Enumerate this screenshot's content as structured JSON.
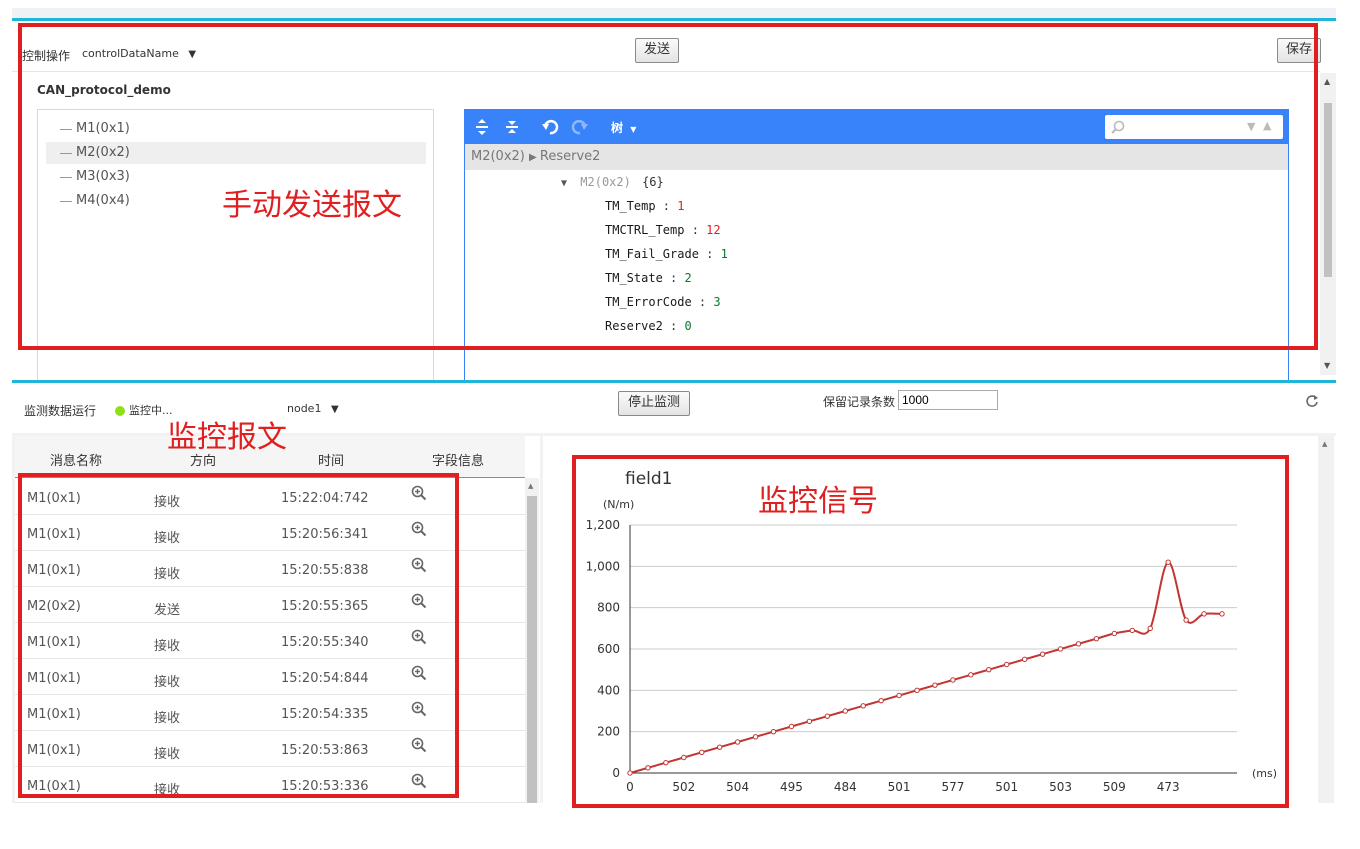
{
  "top": {
    "control_label": "控制操作",
    "control_select": "controlDataName",
    "send_button": "发送",
    "save_button": "保存",
    "protocol_title": "CAN_protocol_demo",
    "tree_items": [
      "M1(0x1)",
      "M2(0x2)",
      "M3(0x3)",
      "M4(0x4)"
    ],
    "selected_tree_index": 1,
    "json_editor": {
      "mode_label": "树",
      "search_placeholder": "",
      "breadcrumb": [
        "M2(0x2)",
        "Reserve2"
      ],
      "root_label": "M2(0x2)",
      "root_count": "{6}",
      "fields": [
        {
          "key": "TM_Temp",
          "value": "1",
          "color": "#e02020"
        },
        {
          "key": "TMCTRL_Temp",
          "value": "12",
          "color": "#e02020"
        },
        {
          "key": "TM_Fail_Grade",
          "value": "1",
          "color": "#0a7a2a"
        },
        {
          "key": "TM_State",
          "value": "2",
          "color": "#0a7a2a"
        },
        {
          "key": "TM_ErrorCode",
          "value": "3",
          "color": "#0a7a2a"
        },
        {
          "key": "Reserve2",
          "value": "0",
          "color": "#0a7a2a"
        }
      ]
    },
    "annotation": "手动发送报文"
  },
  "bottom": {
    "monitor_label": "监测数据运行",
    "status_text": "监控中...",
    "node_select": "node1",
    "stop_button": "停止监测",
    "retain_label": "保留记录条数",
    "retain_value": "1000",
    "table_headers": [
      "消息名称",
      "方向",
      "时间",
      "字段信息"
    ],
    "rows": [
      {
        "name": "M1(0x1)",
        "dir": "接收",
        "time": "15:22:04:742"
      },
      {
        "name": "M1(0x1)",
        "dir": "接收",
        "time": "15:20:56:341"
      },
      {
        "name": "M1(0x1)",
        "dir": "接收",
        "time": "15:20:55:838"
      },
      {
        "name": "M2(0x2)",
        "dir": "发送",
        "time": "15:20:55:365"
      },
      {
        "name": "M1(0x1)",
        "dir": "接收",
        "time": "15:20:55:340"
      },
      {
        "name": "M1(0x1)",
        "dir": "接收",
        "time": "15:20:54:844"
      },
      {
        "name": "M1(0x1)",
        "dir": "接收",
        "time": "15:20:54:335"
      },
      {
        "name": "M1(0x1)",
        "dir": "接收",
        "time": "15:20:53:863"
      },
      {
        "name": "M1(0x1)",
        "dir": "接收",
        "time": "15:20:53:336"
      }
    ],
    "annotation_table": "监控报文",
    "annotation_chart": "监控信号"
  },
  "colors": {
    "accent": "#1fb6d9",
    "editor_blue": "#3883fa",
    "annotation_red": "#e02020",
    "line_color": "#c23531",
    "status_dot": "#8fe01a"
  },
  "chart_data": {
    "type": "line",
    "title": "field1",
    "ylabel": "(N/m)",
    "xlabel": "(ms)",
    "ylim": [
      0,
      1200
    ],
    "yticks": [
      0,
      200,
      400,
      600,
      800,
      1000,
      1200
    ],
    "ytick_labels": [
      "0",
      "200",
      "400",
      "600",
      "800",
      "1,000",
      "1,200"
    ],
    "xtick_labels": [
      "0",
      "502",
      "504",
      "495",
      "484",
      "501",
      "577",
      "501",
      "503",
      "509",
      "473"
    ],
    "series": [
      {
        "values": [
          0,
          25,
          50,
          75,
          100,
          125,
          150,
          175,
          200,
          225,
          250,
          275,
          300,
          325,
          350,
          375,
          400,
          425,
          450,
          475,
          500,
          525,
          550,
          575,
          600,
          625,
          650,
          675,
          690,
          700,
          1020,
          740,
          770,
          770
        ]
      }
    ]
  }
}
